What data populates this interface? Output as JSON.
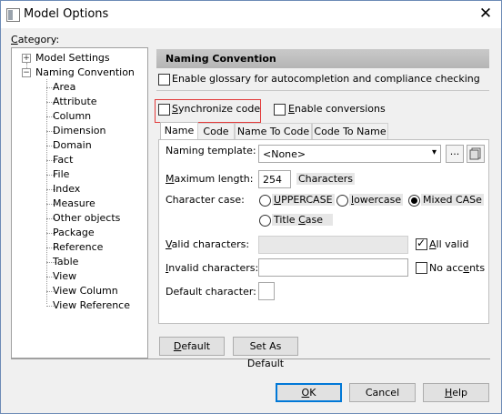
{
  "window": {
    "title": "Model Options",
    "close": "✕"
  },
  "category": {
    "label": "Category:",
    "items": [
      {
        "label": "Model Settings",
        "expander": "+"
      },
      {
        "label": "Naming Convention",
        "expander": "−"
      },
      {
        "label": "Area"
      },
      {
        "label": "Attribute"
      },
      {
        "label": "Column"
      },
      {
        "label": "Dimension"
      },
      {
        "label": "Domain"
      },
      {
        "label": "Fact"
      },
      {
        "label": "File"
      },
      {
        "label": "Index"
      },
      {
        "label": "Measure"
      },
      {
        "label": "Other objects"
      },
      {
        "label": "Package"
      },
      {
        "label": "Reference"
      },
      {
        "label": "Table"
      },
      {
        "label": "View"
      },
      {
        "label": "View Column"
      },
      {
        "label": "View Reference"
      }
    ]
  },
  "panel": {
    "heading": "Naming Convention",
    "glossary": "Enable glossary for autocompletion and compliance checking",
    "sync_code": "Synchronize code",
    "enable_conversions": "Enable conversions"
  },
  "tabs": [
    "Name",
    "Code",
    "Name To Code",
    "Code To Name"
  ],
  "form": {
    "naming_template_label": "Naming template:",
    "naming_template_value": "<None>",
    "browse": "...",
    "max_length_label": "Maximum length:",
    "max_length_value": "254",
    "characters": "Characters",
    "char_case_label": "Character case:",
    "uppercase": "UPPERCASE",
    "lowercase": "lowercase",
    "mixed": "Mixed CASe",
    "titlecase": "Title Case",
    "valid_label": "Valid characters:",
    "all_valid": "All valid",
    "invalid_label": "Invalid characters:",
    "no_accents": "No accents",
    "default_char_label": "Default character:"
  },
  "buttons": {
    "default": "Default",
    "set_as_default": "Set As Default",
    "ok": "OK",
    "cancel": "Cancel",
    "help": "Help"
  },
  "colors": {
    "highlight_box": "#e23a3a",
    "panel_heading": "#bfbfbf",
    "primary_border": "#0078d7"
  }
}
